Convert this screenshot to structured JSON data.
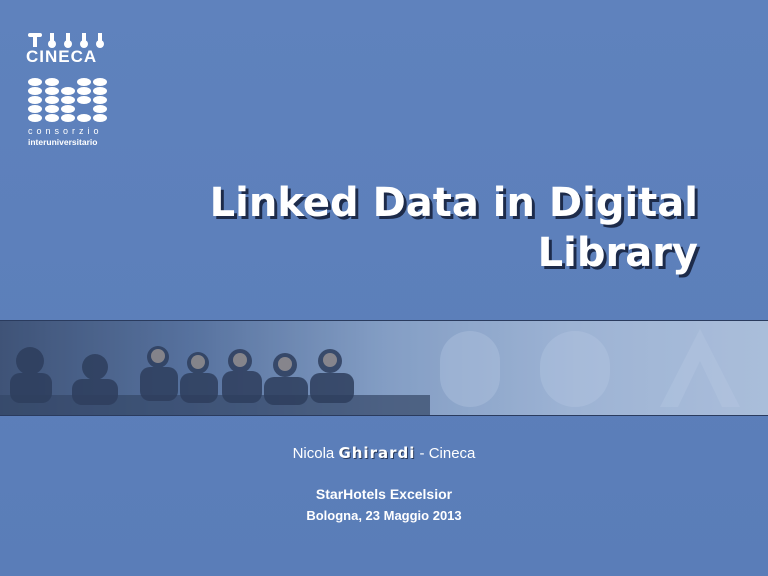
{
  "logo": {
    "name": "CINECA",
    "line1": "consorzio",
    "line2": "interuniversitario",
    "icon": "abacus-logo-icon"
  },
  "title": {
    "line1": "Linked Data in Digital",
    "line2": "Library"
  },
  "author": {
    "first_name": "Nicola",
    "surname": "Ghirardi",
    "organization": "- Cineca"
  },
  "event": {
    "venue": "StarHotels Excelsior",
    "date": "Bologna, 23 Maggio 2013"
  },
  "colors": {
    "background": "#5b7fb9",
    "text": "#ffffff",
    "title_shadow": "#1d2b4a"
  }
}
